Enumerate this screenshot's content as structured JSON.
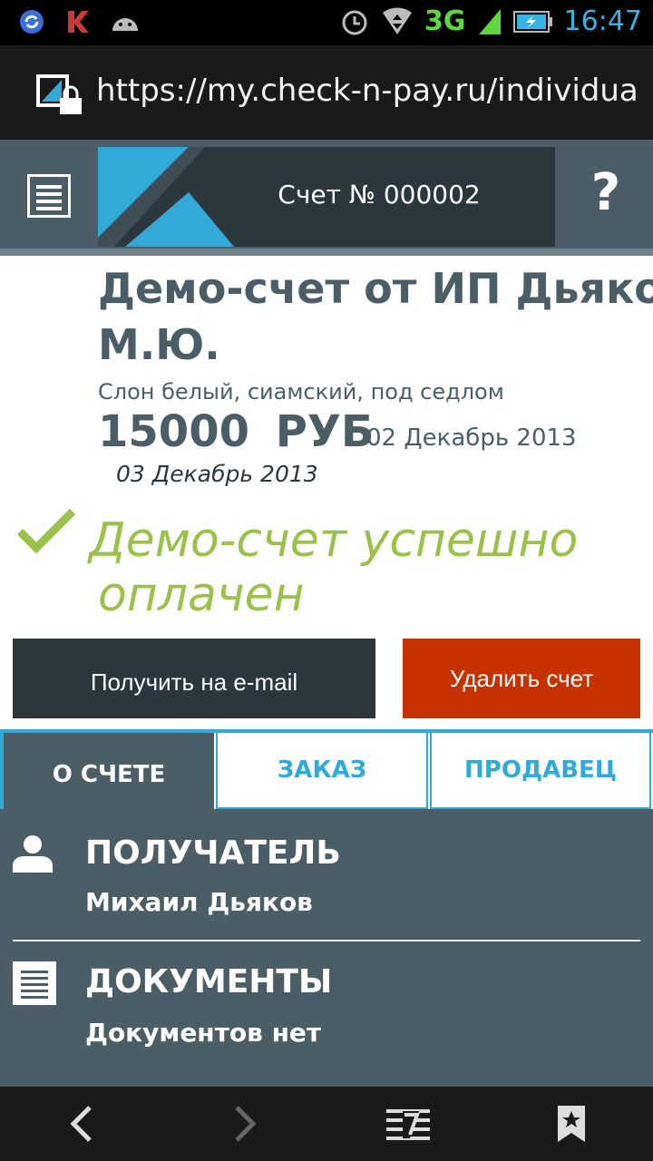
{
  "status_bar": {
    "network": "3G",
    "time": "16:47",
    "icons": [
      "sync-icon",
      "kaspersky-icon",
      "android-icon",
      "alarm-icon",
      "wifi-icon",
      "signal-icon",
      "battery-icon"
    ]
  },
  "browser": {
    "url": "https://my.check-n-pay.ru/individual,"
  },
  "header": {
    "title": "Счет № 000002",
    "help_label": "?"
  },
  "invoice": {
    "title_line1": "Демо-счет от ИП Дьяков",
    "title_line2": "М.Ю.",
    "description": "Слон белый, сиамский, под седлом",
    "amount": "15000",
    "currency": "РУБ",
    "date_issued": "02 Декабрь 2013",
    "date_paid": "03 Декабрь 2013",
    "status_line1": "Демо-счет успешно",
    "status_line2": "оплачен"
  },
  "actions": {
    "email_label": "Получить на e-mail",
    "delete_label": "Удалить счет"
  },
  "tabs": [
    {
      "label": "О СЧЕТЕ",
      "active": true
    },
    {
      "label": "ЗАКАЗ",
      "active": false
    },
    {
      "label": "ПРОДАВЕЦ",
      "active": false
    }
  ],
  "details": {
    "recipient_title": "ПОЛУЧАТЕЛЬ",
    "recipient_value": "Михаил Дьяков",
    "documents_title": "ДОКУМЕНТЫ",
    "documents_value": "Документов нет"
  },
  "colors": {
    "primary": "#4b5d67",
    "dark": "#2c373d",
    "accent": "#33a9d8",
    "success": "#9bc14b",
    "danger": "#c63100"
  }
}
